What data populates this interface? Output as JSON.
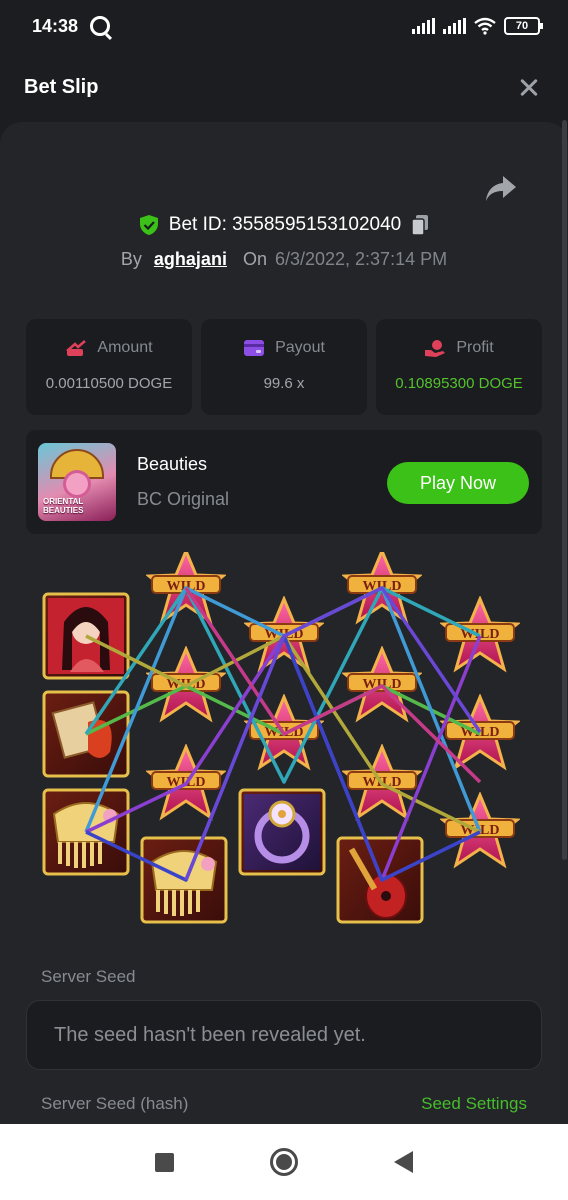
{
  "status": {
    "time": "14:38",
    "battery": "70"
  },
  "header": {
    "title": "Bet Slip"
  },
  "bet": {
    "id_text": "Bet ID: 3558595153102040",
    "by_label": "By",
    "username": "aghajani",
    "on_label": "On",
    "date": "6/3/2022, 2:37:14 PM"
  },
  "stats": {
    "amount": {
      "label": "Amount",
      "value": "0.00110500 DOGE"
    },
    "payout": {
      "label": "Payout",
      "value": "99.6 x"
    },
    "profit": {
      "label": "Profit",
      "value": "0.10895300 DOGE"
    }
  },
  "game": {
    "name": "Beauties",
    "provider": "BC Original",
    "play_label": "Play Now",
    "thumb_text": "ORIENTAL BEAUTIES"
  },
  "reels": {
    "wild_text": "WILD",
    "symbols": [
      "beauty",
      "fan-scroll",
      "comb",
      "comb",
      "wild",
      "wild",
      "wild",
      "wild",
      "wild",
      "ring",
      "wild",
      "wild",
      "wild",
      "wild",
      "wild",
      "pipa",
      "wild",
      "wild",
      "wild"
    ],
    "line_colors": [
      "#3f9ad6",
      "#8b3fd0",
      "#c63a8a",
      "#55b84a",
      "#3b44c9",
      "#2fa7b8",
      "#b0a83a"
    ]
  },
  "seed": {
    "server_seed_label": "Server Seed",
    "server_seed_value": "The seed hasn't been revealed yet.",
    "hash_label": "Server Seed (hash)",
    "settings_label": "Seed Settings"
  },
  "colors": {
    "accent": "#3bc117",
    "background": "#1b1d20",
    "card": "#1a1c1f"
  }
}
